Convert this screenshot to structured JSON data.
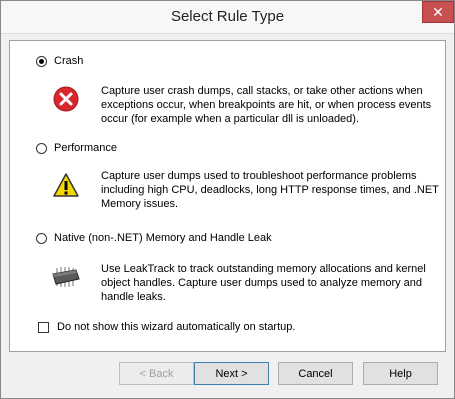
{
  "window": {
    "title": "Select Rule Type",
    "close_glyph": "✕"
  },
  "options": [
    {
      "label": "Crash",
      "selected": true,
      "icon": "error-icon",
      "description": "Capture user crash dumps, call stacks, or take other actions when exceptions occur, when breakpoints are hit, or when process events occur (for example when a particular dll is unloaded)."
    },
    {
      "label": "Performance",
      "selected": false,
      "icon": "warning-icon",
      "description": "Capture user dumps used to troubleshoot performance problems including high CPU, deadlocks, long HTTP response times, and .NET Memory issues."
    },
    {
      "label": "Native (non-.NET) Memory and Handle Leak",
      "selected": false,
      "icon": "memory-chip-icon",
      "description": "Use LeakTrack to track outstanding memory allocations and kernel object handles. Capture user dumps used to analyze memory and handle leaks."
    }
  ],
  "startup_checkbox": {
    "label": "Do not show this wizard automatically on startup.",
    "checked": false
  },
  "buttons": {
    "back": "< Back",
    "next": "Next >",
    "cancel": "Cancel",
    "help": "Help"
  },
  "colors": {
    "error_red": "#d9272d",
    "warning_yellow": "#f5d800",
    "close_red": "#c75050"
  }
}
